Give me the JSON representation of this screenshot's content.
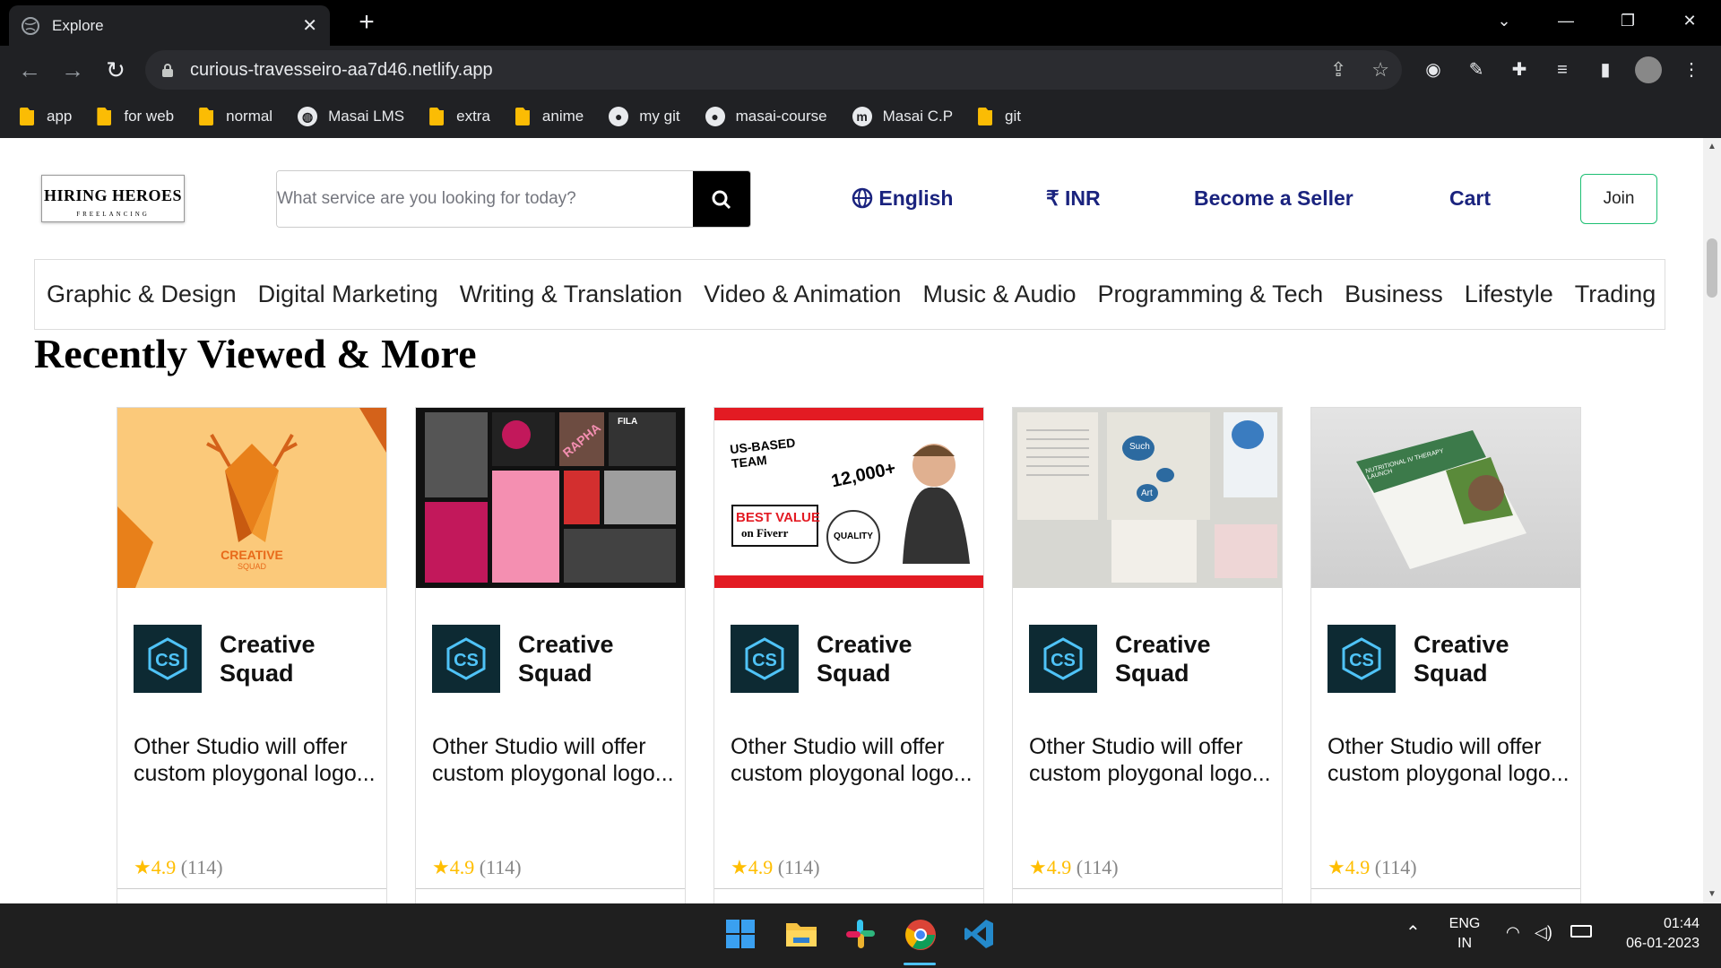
{
  "browser": {
    "tab_title": "Explore",
    "new_tab_symbol": "+",
    "url": "curious-travesseiro-aa7d46.netlify.app",
    "bookmarks": [
      {
        "label": "app",
        "icon": "folder-icon"
      },
      {
        "label": "for web",
        "icon": "folder-icon"
      },
      {
        "label": "normal",
        "icon": "folder-icon"
      },
      {
        "label": "Masai LMS",
        "icon": "globe-icon"
      },
      {
        "label": "extra",
        "icon": "folder-icon"
      },
      {
        "label": "anime",
        "icon": "folder-icon"
      },
      {
        "label": "my git",
        "icon": "github-icon"
      },
      {
        "label": "masai-course",
        "icon": "github-icon"
      },
      {
        "label": "Masai C.P",
        "icon": "m-icon"
      },
      {
        "label": "git",
        "icon": "folder-icon"
      }
    ]
  },
  "header": {
    "logo_line1": "HIRING HEROES",
    "logo_line2": "FREELANCING",
    "search_placeholder": "What service are you looking for today?",
    "language": "English",
    "currency": "₹ INR",
    "become_seller": "Become a Seller",
    "cart": "Cart",
    "join": "Join"
  },
  "categories": [
    "Graphic & Design",
    "Digital Marketing",
    "Writing & Translation",
    "Video & Animation",
    "Music & Audio",
    "Programming & Tech",
    "Business",
    "Lifestyle",
    "Trading"
  ],
  "section_title": "Recently Viewed & More",
  "cards": [
    {
      "thumb_text": "CREATIVE",
      "thumb_sub": "SQUAD",
      "seller": "Creative Squad",
      "desc": "Other Studio will offer custom ploygonal logo...",
      "rating": "4.9",
      "count": "(114)"
    },
    {
      "thumb_text": "RAPHA",
      "thumb_sub": "FILA",
      "seller": "Creative Squad",
      "desc": "Other Studio will offer custom ploygonal logo...",
      "rating": "4.9",
      "count": "(114)"
    },
    {
      "thumb_text": "US-BASED TEAM",
      "thumb_sub": "12,000+",
      "seller": "Creative Squad",
      "desc": "Other Studio will offer custom ploygonal logo...",
      "rating": "4.9",
      "count": "(114)"
    },
    {
      "thumb_text": "Such",
      "thumb_sub": "Art",
      "seller": "Creative Squad",
      "desc": "Other Studio will offer custom ploygonal logo...",
      "rating": "4.9",
      "count": "(114)"
    },
    {
      "thumb_text": "NUTRITIONAL IV THERAPY LAUNCH",
      "thumb_sub": "",
      "seller": "Creative Squad",
      "desc": "Other Studio will offer custom ploygonal logo...",
      "rating": "4.9",
      "count": "(114)"
    }
  ],
  "card3_extra": {
    "best": "BEST VALUE",
    "fiverr": "on Fiverr",
    "quality": "QUALITY"
  },
  "taskbar": {
    "lang1": "ENG",
    "lang2": "IN",
    "time": "01:44",
    "date": "06-01-2023"
  },
  "colors": {
    "accent_green": "#1dbf73",
    "nav_blue": "#1a237e",
    "star": "#ffbe00"
  }
}
